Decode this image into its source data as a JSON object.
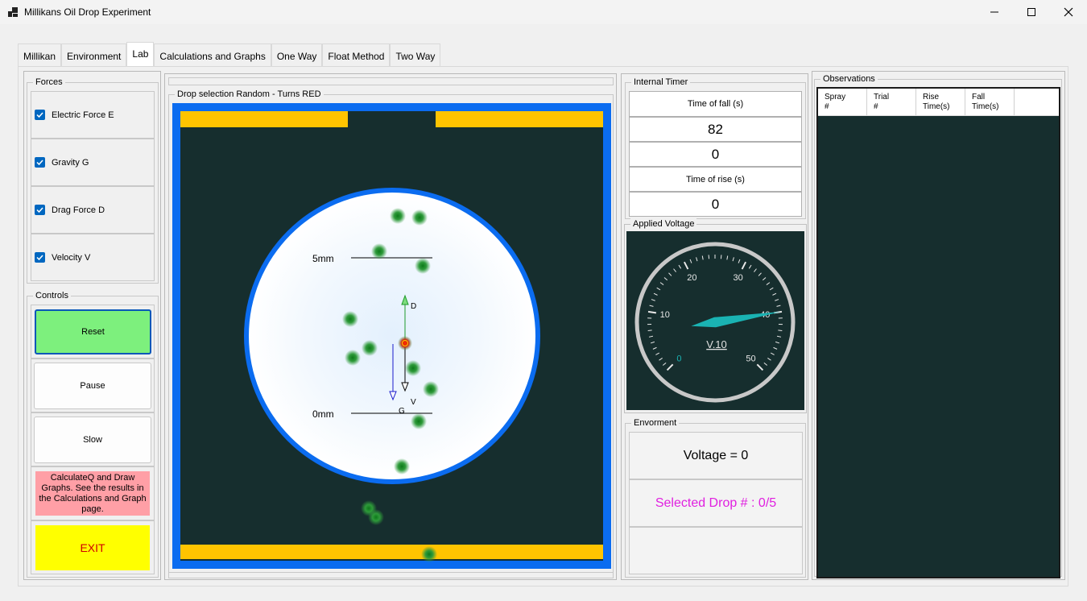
{
  "window": {
    "title": "Millikans Oil Drop Experiment"
  },
  "tabs": [
    {
      "label": "Millikan",
      "active": false
    },
    {
      "label": "Environment",
      "active": false
    },
    {
      "label": "Lab",
      "active": true
    },
    {
      "label": "Calculations and Graphs",
      "active": false
    },
    {
      "label": "One Way",
      "active": false
    },
    {
      "label": "Float Method",
      "active": false
    },
    {
      "label": "Two Way",
      "active": false
    }
  ],
  "forces": {
    "title": "Forces",
    "items": [
      {
        "label": "Electric Force E",
        "checked": true
      },
      {
        "label": "Gravity G",
        "checked": true
      },
      {
        "label": "Drag Force D",
        "checked": true
      },
      {
        "label": "Velocity V",
        "checked": true
      }
    ]
  },
  "controls": {
    "title": "Controls",
    "reset": "Reset",
    "pause": "Pause",
    "slow": "Slow",
    "calculate": "CalculateQ and Draw Graphs. See the results in the Calculations and Graph page.",
    "exit": "EXIT"
  },
  "simulation": {
    "title": "Drop selection Random - Turns RED",
    "label_top": "5mm",
    "label_bottom": "0mm",
    "vec_d": "D",
    "vec_v": "V",
    "vec_g": "G"
  },
  "timer": {
    "title": "Internal Timer",
    "fall_label": "Time of fall (s)",
    "fall_value": "82",
    "second_value": "0",
    "rise_label": "Time of rise (s)",
    "rise_value": "0"
  },
  "voltage": {
    "title": "Applied Voltage",
    "gauge_label": "V.10",
    "ticks": [
      "0",
      "10",
      "20",
      "30",
      "40",
      "50"
    ],
    "needle_value": 40
  },
  "environment": {
    "title": "Envorment",
    "voltage_text": "Voltage = 0",
    "selected_drop": "Selected Drop # : 0/5"
  },
  "observations": {
    "title": "Observations",
    "columns": [
      {
        "line1": "Spray",
        "line2": "#"
      },
      {
        "line1": "Trial",
        "line2": "#"
      },
      {
        "line1": "Rise",
        "line2": "Time(s)"
      },
      {
        "line1": "Fall",
        "line2": "Time(s)"
      }
    ]
  },
  "colors": {
    "dark_bg": "#162e2e",
    "plate_yellow": "#ffc400",
    "frame_blue": "#0b6cf0",
    "reset_green": "#7df07d",
    "calc_pink": "#ff9fa6",
    "exit_yellow": "#ffff00",
    "gauge_needle": "#1ab3b3",
    "selected_text": "#e020e0"
  }
}
